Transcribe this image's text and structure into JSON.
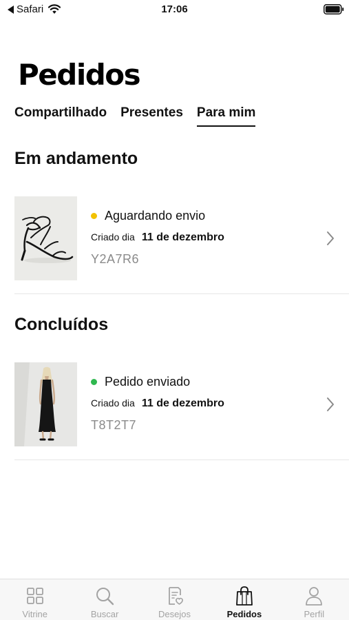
{
  "status_bar": {
    "back_app": "Safari",
    "time": "17:06"
  },
  "page": {
    "title": "Pedidos"
  },
  "tabs": [
    {
      "label": "Compartilhado",
      "active": false
    },
    {
      "label": "Presentes",
      "active": false
    },
    {
      "label": "Para mim",
      "active": true
    }
  ],
  "sections": {
    "in_progress": {
      "title": "Em andamento",
      "order": {
        "status": "Aguardando envio",
        "status_color": "#f2c200",
        "created_label": "Criado dia",
        "created_date": "11 de dezembro",
        "code": "Y2A7R6",
        "thumb_icon": "strappy-heel-sandal-image"
      }
    },
    "completed": {
      "title": "Concluídos",
      "order": {
        "status": "Pedido enviado",
        "status_color": "#2fb84f",
        "created_label": "Criado dia",
        "created_date": "11 de dezembro",
        "code": "T8T2T7",
        "thumb_icon": "black-dress-model-image"
      }
    }
  },
  "tabbar": [
    {
      "label": "Vitrine",
      "icon": "grid-icon",
      "active": false
    },
    {
      "label": "Buscar",
      "icon": "search-icon",
      "active": false
    },
    {
      "label": "Desejos",
      "icon": "wishlist-icon",
      "active": false
    },
    {
      "label": "Pedidos",
      "icon": "shopping-bag-icon",
      "active": true
    },
    {
      "label": "Perfil",
      "icon": "person-icon",
      "active": false
    }
  ]
}
